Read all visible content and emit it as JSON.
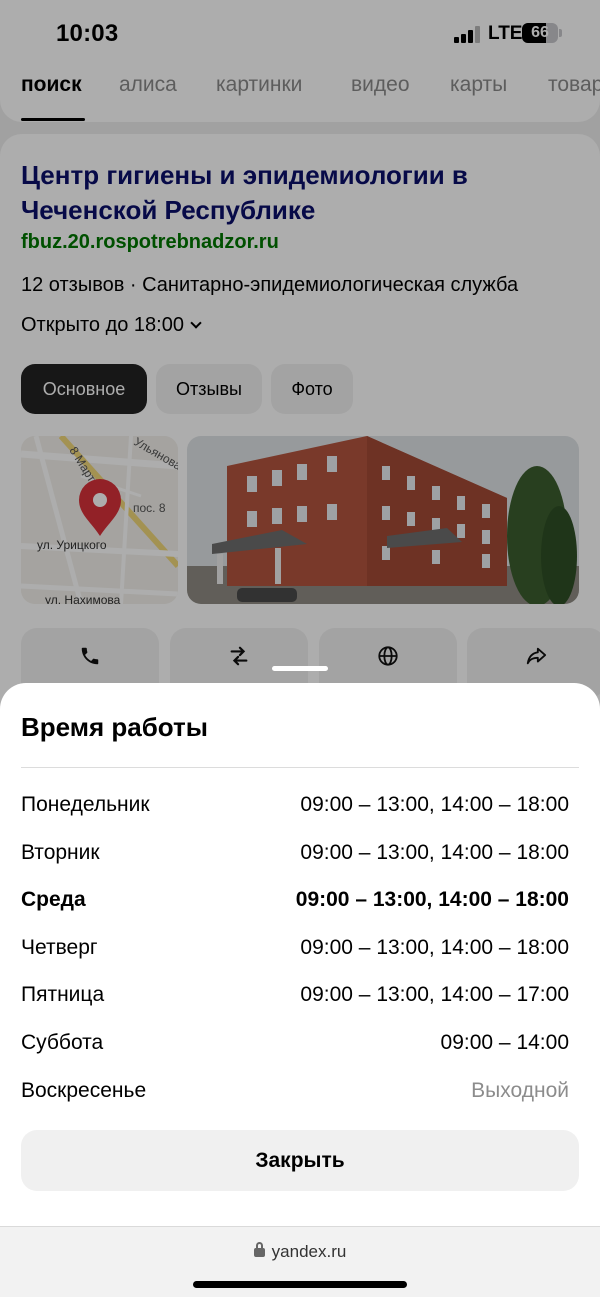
{
  "status_bar": {
    "time": "10:03",
    "network": "LTE",
    "battery": "66",
    "battery_level": 0.66
  },
  "search_tabs": [
    "поиск",
    "алиса",
    "картинки",
    "видео",
    "карты",
    "товары"
  ],
  "organization": {
    "title": "Центр гигиены и эпидемиологии в Чеченской Республике",
    "url": "fbuz.20.rospotrebnadzor.ru",
    "meta": "12 отзывов · Санитарно-эпидемиологическая служба",
    "open_status": "Открыто до 18:00",
    "chips": [
      "Основное",
      "Отзывы",
      "Фото"
    ],
    "map_labels": {
      "street_top": "8 Марта",
      "street_right": "Ульянова",
      "label_pos": "пос. 8",
      "street_mid": "ул. Урицкого",
      "street_bottom": "ул. Нахимова"
    },
    "actions": [
      "phone-icon",
      "route-icon",
      "globe-icon",
      "share-icon"
    ]
  },
  "hours_sheet": {
    "title": "Время работы",
    "days": [
      {
        "day": "Понедельник",
        "hours": "09:00 – 13:00, 14:00 – 18:00"
      },
      {
        "day": "Вторник",
        "hours": "09:00 – 13:00, 14:00 – 18:00"
      },
      {
        "day": "Среда",
        "hours": "09:00 – 13:00, 14:00 – 18:00"
      },
      {
        "day": "Четверг",
        "hours": "09:00 – 13:00, 14:00 – 18:00"
      },
      {
        "day": "Пятница",
        "hours": "09:00 – 13:00, 14:00 – 17:00"
      },
      {
        "day": "Суббота",
        "hours": "09:00 – 14:00"
      },
      {
        "day": "Воскресенье",
        "hours": "Выходной"
      }
    ],
    "today": "Среда",
    "close_label": "Закрыть"
  },
  "browser": {
    "url": "yandex.ru"
  },
  "colors": {
    "title_blue": "#0b0f6b",
    "url_green": "#007700",
    "pin_red": "#d8323a",
    "overlay": "rgba(0,0,0,0.32)"
  }
}
